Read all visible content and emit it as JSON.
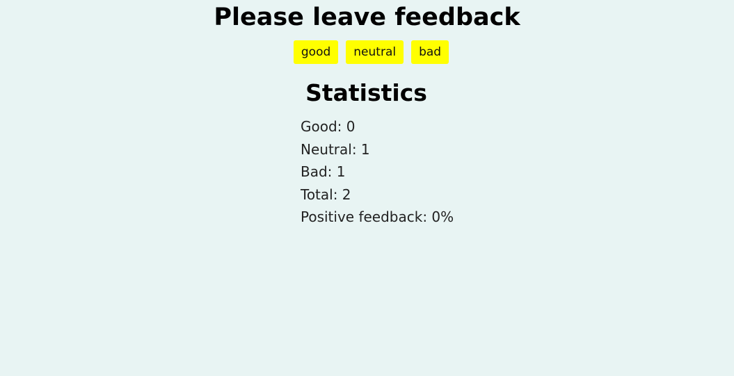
{
  "header": {
    "title": "Please leave feedback"
  },
  "buttons": {
    "good_label": "good",
    "neutral_label": "neutral",
    "bad_label": "bad"
  },
  "statistics": {
    "title": "Statistics",
    "good": "Good: 0",
    "neutral": "Neutral: 1",
    "bad": "Bad: 1",
    "total": "Total: 2",
    "positive": "Positive feedback: 0%"
  },
  "colors": {
    "background": "#e8f4f3",
    "button": "#ffff00"
  }
}
